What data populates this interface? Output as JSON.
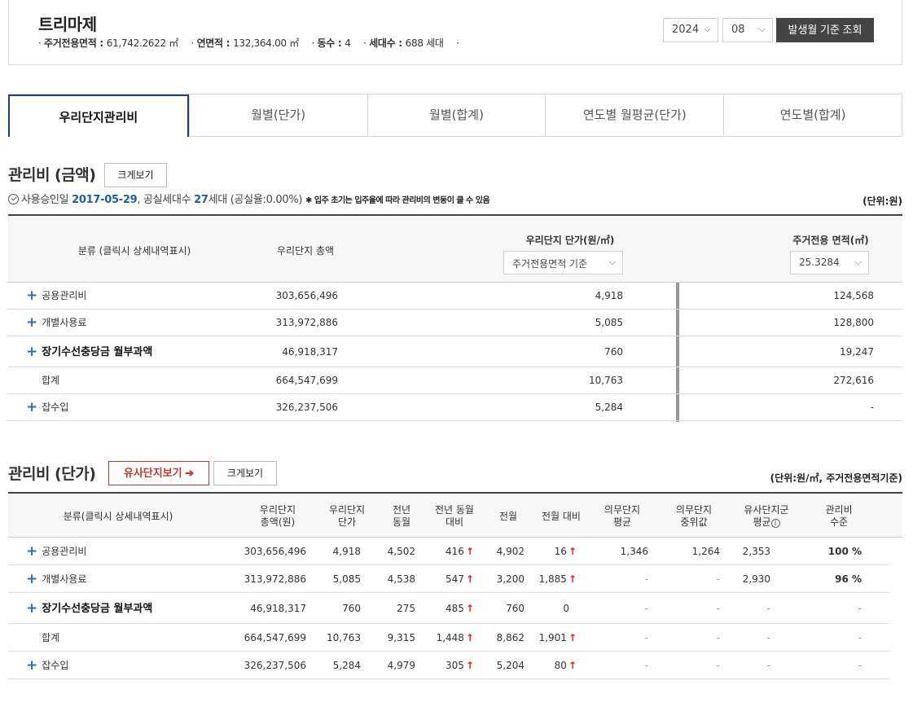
{
  "header": {
    "apt_name": "트리마제",
    "info": [
      {
        "label": "주거전용면적",
        "value": "61,742.2622 ㎡"
      },
      {
        "label": "연면적",
        "value": "132,364.00 ㎡"
      },
      {
        "label": "동수",
        "value": "4"
      },
      {
        "label": "세대수",
        "value": "688 세대"
      }
    ],
    "year": "2024",
    "month": "08",
    "search_label": "발생월 기준 조회"
  },
  "tabs": [
    "우리단지관리비",
    "월별(단가)",
    "월별(합계)",
    "연도별 월평균(단가)",
    "연도별(합계)"
  ],
  "section1": {
    "title": "관리비 (금액)",
    "enlarge_label": "크게보기",
    "info_prefix": "사용승인일",
    "approval_date": "2017-05-29",
    "vacancy_label": ", 공실세대수",
    "vacancy_count": "27",
    "vacancy_suffix": "세대 (공실율:0.00%)",
    "note": "✱ 입주 초기는 입주율에 따라 관리비의 변동이 클 수 있음",
    "unit": "(단위:원)",
    "headers": {
      "category": "분류 (클릭시 상세내역표시)",
      "total": "우리단지 총액",
      "unit_price": "우리단지 단가(원/㎡)",
      "unit_price_select": "주거전용면적 기준",
      "area": "주거전용 면적(㎡)",
      "area_select": "25.3284"
    },
    "rows": [
      {
        "name": "공용관리비",
        "total": "303,656,496",
        "unit": "4,918",
        "area": "124,568"
      },
      {
        "name": "개별사용료",
        "total": "313,972,886",
        "unit": "5,085",
        "area": "128,800"
      },
      {
        "name": "장기수선충당금 월부과액",
        "total": "46,918,317",
        "unit": "760",
        "area": "19,247"
      },
      {
        "name": "합계",
        "total": "664,547,699",
        "unit": "10,763",
        "area": "272,616"
      },
      {
        "name": "잡수입",
        "total": "326,237,506",
        "unit": "5,284",
        "area": "-"
      }
    ]
  },
  "section2": {
    "title": "관리비 (단가)",
    "similar_label": "유사단지보기 ➔",
    "enlarge_label": "크게보기",
    "unit": "(단위:원/㎡, 주거전용면적기준)",
    "headers": {
      "category": "분류(클릭시 상세내역표시)",
      "total_1": "우리단지",
      "total_2": "총액(원)",
      "unit_1": "우리단지",
      "unit_2": "단가",
      "prev_year_1": "전년",
      "prev_year_2": "동월",
      "prev_year_cmp_1": "전년 동월",
      "prev_year_cmp_2": "대비",
      "prev_month": "전월",
      "prev_month_cmp": "전월 대비",
      "mand_avg_1": "의무단지",
      "mand_avg_2": "평균",
      "mand_med_1": "의무단지",
      "mand_med_2": "중위값",
      "sim_avg_1": "유사단지군",
      "sim_avg_2": "평균",
      "level_1": "관리비",
      "level_2": "수준"
    },
    "rows": [
      {
        "name": "공용관리비",
        "total": "303,656,496",
        "unit": "4,918",
        "prev_year": "4,502",
        "yoy": "416",
        "prev_month": "4,902",
        "mom": "16",
        "mand_avg": "1,346",
        "mand_med": "1,264",
        "sim_avg": "2,353",
        "level": "100 %"
      },
      {
        "name": "개별사용료",
        "total": "313,972,886",
        "unit": "5,085",
        "prev_year": "4,538",
        "yoy": "547",
        "prev_month": "3,200",
        "mom": "1,885",
        "mand_avg": "-",
        "mand_med": "-",
        "sim_avg": "2,930",
        "level": "96 %"
      },
      {
        "name": "장기수선충당금 월부과액",
        "total": "46,918,317",
        "unit": "760",
        "prev_year": "275",
        "yoy": "485",
        "prev_month": "760",
        "mom": "0",
        "mand_avg": "-",
        "mand_med": "-",
        "sim_avg": "-",
        "level": "-"
      },
      {
        "name": "합계",
        "total": "664,547,699",
        "unit": "10,763",
        "prev_year": "9,315",
        "yoy": "1,448",
        "prev_month": "8,862",
        "mom": "1,901",
        "mand_avg": "-",
        "mand_med": "-",
        "sim_avg": "-",
        "level": "-"
      },
      {
        "name": "잡수입",
        "total": "326,237,506",
        "unit": "5,284",
        "prev_year": "4,979",
        "yoy": "305",
        "prev_month": "5,204",
        "mom": "80",
        "mand_avg": "-",
        "mand_med": "-",
        "sim_avg": "-",
        "level": "-"
      }
    ]
  }
}
